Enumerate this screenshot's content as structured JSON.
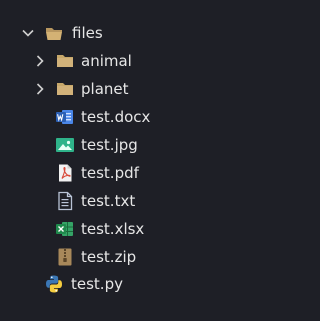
{
  "explorer": {
    "root": {
      "label": "files",
      "expanded": true,
      "icon": "folder-open-icon"
    },
    "folders": [
      {
        "label": "animal",
        "expanded": false,
        "icon": "folder-icon"
      },
      {
        "label": "planet",
        "expanded": false,
        "icon": "folder-icon"
      }
    ],
    "files": [
      {
        "label": "test.docx",
        "icon": "word-icon"
      },
      {
        "label": "test.jpg",
        "icon": "image-icon"
      },
      {
        "label": "test.pdf",
        "icon": "pdf-icon"
      },
      {
        "label": "test.txt",
        "icon": "text-file-icon"
      },
      {
        "label": "test.xlsx",
        "icon": "excel-icon"
      },
      {
        "label": "test.zip",
        "icon": "zip-icon"
      }
    ],
    "outside": [
      {
        "label": "test.py",
        "icon": "python-icon"
      }
    ]
  },
  "colors": {
    "background": "#1e1f26",
    "text": "#e6e6e6",
    "folder": "#c7a86a",
    "word": "#2b5fb4",
    "image": "#2fb38a",
    "pdf": "#d84a3a",
    "excel": "#1f8a4c"
  }
}
